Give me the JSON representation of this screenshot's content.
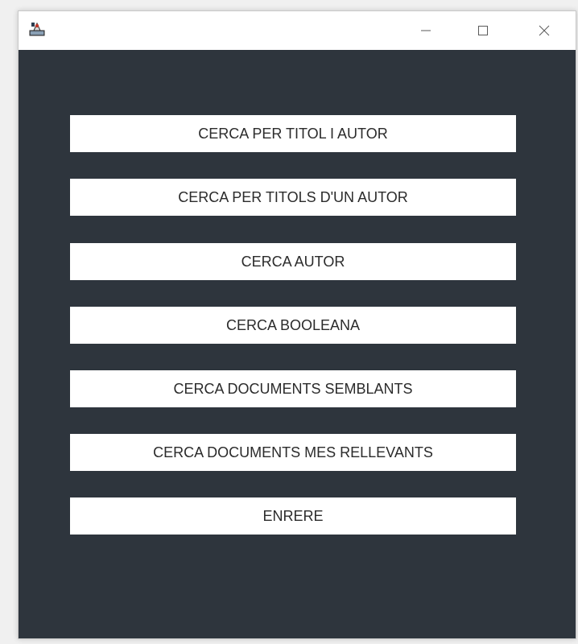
{
  "window": {
    "title": "",
    "app_icon": "java-app-icon",
    "controls": {
      "minimize_icon": "minimize-icon",
      "maximize_icon": "maximize-icon",
      "close_icon": "close-icon"
    }
  },
  "colors": {
    "content_background": "#2e353d",
    "titlebar_background": "#ffffff",
    "button_background": "#ffffff",
    "button_text": "#2b2b2b"
  },
  "menu": {
    "buttons": [
      {
        "label": "CERCA PER TITOL I AUTOR"
      },
      {
        "label": "CERCA PER TITOLS D'UN AUTOR"
      },
      {
        "label": "CERCA AUTOR"
      },
      {
        "label": "CERCA BOOLEANA"
      },
      {
        "label": "CERCA DOCUMENTS SEMBLANTS"
      },
      {
        "label": "CERCA DOCUMENTS MES RELLEVANTS"
      },
      {
        "label": "ENRERE"
      }
    ]
  }
}
